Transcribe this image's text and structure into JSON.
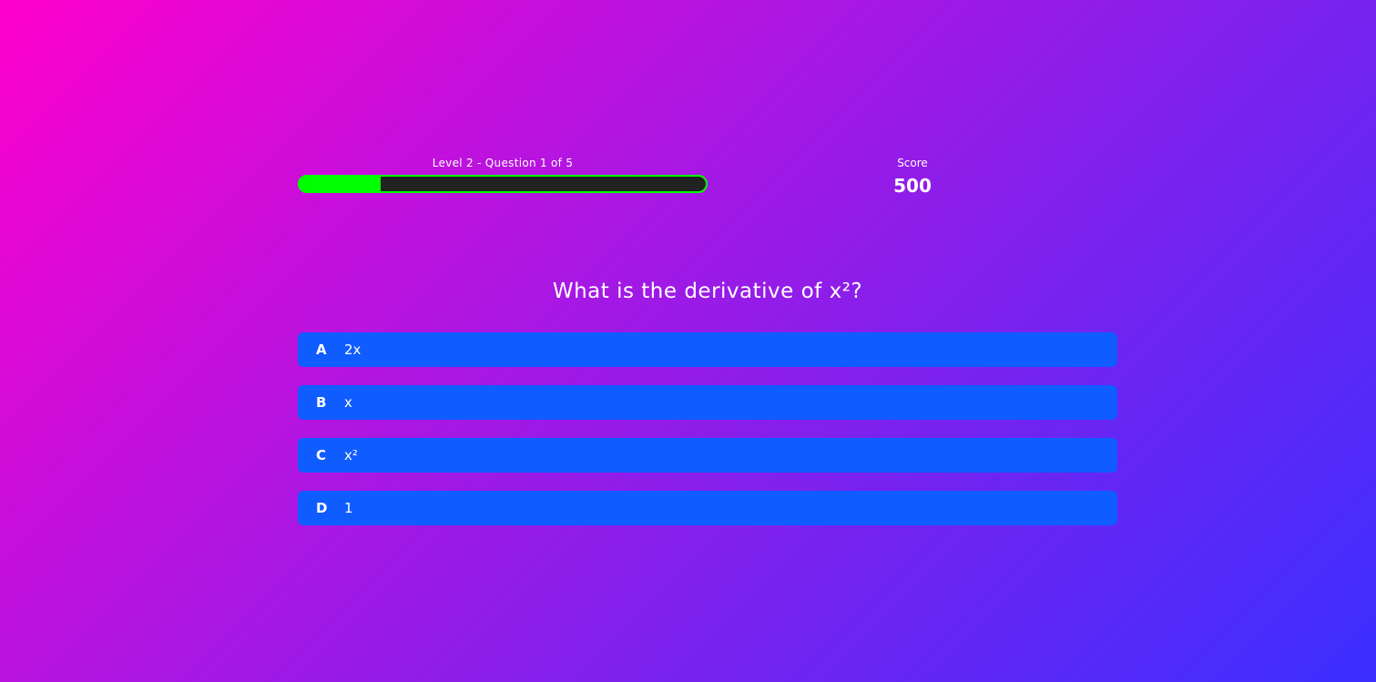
{
  "header": {
    "level_label": "Level 2 - Question 1 of 5",
    "progress_fraction": 0.2,
    "score_label": "Score",
    "score_value": "500"
  },
  "question": {
    "text": "What is the derivative of x²?"
  },
  "answers": [
    {
      "letter": "A",
      "text": "2x"
    },
    {
      "letter": "B",
      "text": "x"
    },
    {
      "letter": "C",
      "text": "x²"
    },
    {
      "letter": "D",
      "text": "1"
    }
  ],
  "colors": {
    "progress_fill": "#00ff00",
    "progress_track": "#222222",
    "answer_bg": "#0f5cff"
  }
}
